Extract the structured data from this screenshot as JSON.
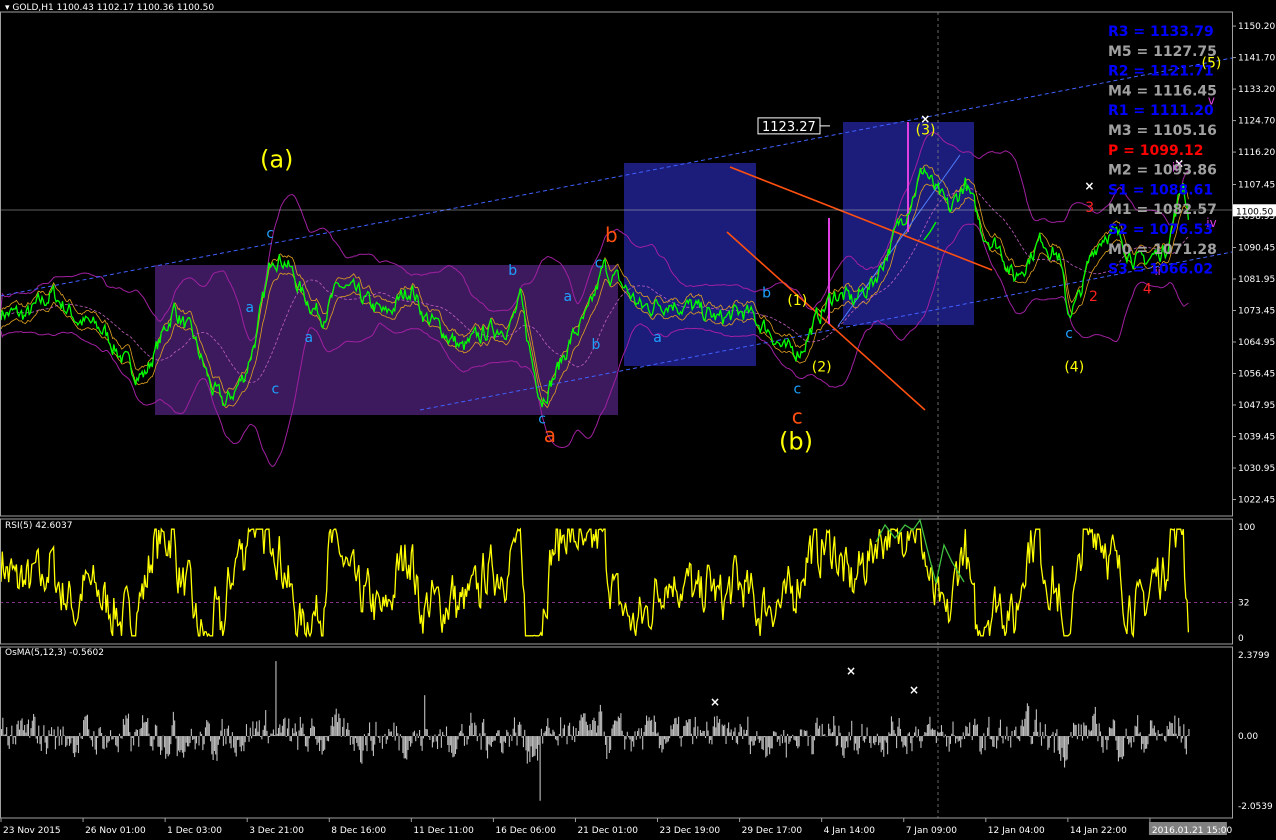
{
  "window": {
    "title": "GOLD,H1  1100.43 1102.17 1100.36 1100.50",
    "rsi_title": "RSI(5) 42.6037",
    "osma_title": "OsMA(5,12,3) -0.5602"
  },
  "colors": {
    "background": "#000000",
    "price_line": "#00ff00",
    "rsi_line": "#ffff00",
    "osma_bars": "#c0c0c0",
    "envelope": "#a020a0",
    "channel": "#4060ff",
    "trend": "#ff5010",
    "box_purple": "#3d1a5e",
    "box_blue": "#1c1c7a",
    "pivot_blue": "#0000ff",
    "pivot_gray": "#a0a0a0",
    "pivot_red": "#ff0000"
  },
  "chart_data": [
    {
      "type": "line",
      "panel": "price",
      "symbol": "GOLD",
      "timeframe": "H1",
      "ylim": [
        1018.0,
        1154.0
      ],
      "y_ticks": [
        "1150.20",
        "1141.70",
        "1133.20",
        "1124.70",
        "1116.20",
        "1107.45",
        "1098.95",
        "1090.45",
        "1081.95",
        "1073.45",
        "1064.95",
        "1056.45",
        "1047.95",
        "1039.45",
        "1030.95",
        "1022.45"
      ],
      "y_tick_values": [
        1150.2,
        1141.7,
        1133.2,
        1124.7,
        1116.2,
        1107.45,
        1098.95,
        1090.45,
        1081.95,
        1073.45,
        1064.95,
        1056.45,
        1047.95,
        1039.45,
        1030.95,
        1022.45
      ],
      "x_ticks": [
        "23 Nov 2015",
        "26 Nov 01:00",
        "1 Dec 03:00",
        "3 Dec 21:00",
        "8 Dec 16:00",
        "11 Dec 11:00",
        "16 Dec 06:00",
        "21 Dec 01:00",
        "23 Dec 19:00",
        "29 Dec 17:00",
        "4 Jan 14:00",
        "7 Jan 09:00",
        "12 Jan 04:00",
        "14 Jan 22:00",
        "2016.01.21 15:00"
      ],
      "x_tick_index": [
        0,
        64,
        128,
        192,
        256,
        320,
        384,
        448,
        512,
        576,
        640,
        704,
        768,
        832,
        896
      ],
      "current_price": "1100.50",
      "current_value": 1100.5,
      "marker_label": "1123.27",
      "marker_value": 1123.27,
      "pivots": [
        {
          "label": "R3",
          "value": "1133.79",
          "color": "#0000ff"
        },
        {
          "label": "M5",
          "value": "1127.75",
          "color": "#a0a0a0"
        },
        {
          "label": "R2",
          "value": "1121.71",
          "color": "#0000ff"
        },
        {
          "label": "M4",
          "value": "1116.45",
          "color": "#a0a0a0"
        },
        {
          "label": "R1",
          "value": "1111.20",
          "color": "#0000ff"
        },
        {
          "label": "M3",
          "value": "1105.16",
          "color": "#a0a0a0"
        },
        {
          "label": "P",
          "value": "1099.12",
          "color": "#ff0000"
        },
        {
          "label": "M2",
          "value": "1093.86",
          "color": "#a0a0a0"
        },
        {
          "label": "S1",
          "value": "1088.61",
          "color": "#0000ff"
        },
        {
          "label": "M1",
          "value": "1082.57",
          "color": "#a0a0a0"
        },
        {
          "label": "S2",
          "value": "1076.53",
          "color": "#0000ff"
        },
        {
          "label": "M0",
          "value": "1071.28",
          "color": "#a0a0a0"
        },
        {
          "label": "S3",
          "value": "1066.02",
          "color": "#0000ff"
        }
      ],
      "price_anchors": [
        [
          0,
          1073
        ],
        [
          20,
          1072
        ],
        [
          40,
          1078
        ],
        [
          60,
          1071
        ],
        [
          80,
          1068
        ],
        [
          100,
          1058
        ],
        [
          112,
          1056
        ],
        [
          125,
          1066
        ],
        [
          135,
          1074
        ],
        [
          150,
          1066
        ],
        [
          165,
          1052
        ],
        [
          175,
          1048
        ],
        [
          190,
          1056
        ],
        [
          200,
          1068
        ],
        [
          212,
          1089
        ],
        [
          222,
          1087
        ],
        [
          235,
          1078
        ],
        [
          250,
          1072
        ],
        [
          265,
          1080
        ],
        [
          280,
          1077
        ],
        [
          300,
          1072
        ],
        [
          320,
          1080
        ],
        [
          330,
          1072
        ],
        [
          345,
          1068
        ],
        [
          360,
          1063
        ],
        [
          380,
          1068
        ],
        [
          398,
          1070
        ],
        [
          405,
          1076
        ],
        [
          415,
          1058
        ],
        [
          422,
          1050
        ],
        [
          432,
          1056
        ],
        [
          445,
          1066
        ],
        [
          458,
          1072
        ],
        [
          470,
          1085
        ],
        [
          485,
          1080
        ],
        [
          500,
          1074
        ],
        [
          520,
          1076
        ],
        [
          540,
          1074
        ],
        [
          560,
          1071
        ],
        [
          580,
          1073
        ],
        [
          600,
          1068
        ],
        [
          612,
          1062
        ],
        [
          624,
          1063
        ],
        [
          636,
          1071
        ],
        [
          650,
          1078
        ],
        [
          665,
          1076
        ],
        [
          680,
          1081
        ],
        [
          695,
          1092
        ],
        [
          710,
          1104
        ],
        [
          720,
          1112
        ],
        [
          728,
          1106
        ],
        [
          740,
          1100
        ],
        [
          752,
          1108
        ],
        [
          765,
          1095
        ],
        [
          780,
          1090
        ],
        [
          790,
          1082
        ],
        [
          800,
          1087
        ],
        [
          812,
          1093
        ],
        [
          825,
          1088
        ],
        [
          832,
          1073
        ],
        [
          840,
          1076
        ],
        [
          846,
          1083
        ],
        [
          852,
          1090
        ],
        [
          862,
          1095
        ],
        [
          875,
          1092
        ],
        [
          888,
          1086
        ],
        [
          898,
          1088
        ],
        [
          908,
          1090
        ],
        [
          916,
          1100
        ],
        [
          922,
          1108
        ],
        [
          926,
          1100
        ]
      ],
      "annotations": [
        {
          "text": "(a)",
          "color": "#ffff00",
          "index": 215,
          "value": 1112,
          "size": 24
        },
        {
          "text": "(b)",
          "color": "#ffff00",
          "index": 620,
          "value": 1036,
          "size": 24
        },
        {
          "text": "(1)",
          "color": "#ffff00",
          "index": 621,
          "value": 1075,
          "size": 14
        },
        {
          "text": "(2)",
          "color": "#ffff00",
          "index": 640,
          "value": 1057,
          "size": 14
        },
        {
          "text": "(3)",
          "color": "#ffff00",
          "index": 721,
          "value": 1121,
          "size": 14
        },
        {
          "text": "(4)",
          "color": "#ffff00",
          "index": 837,
          "value": 1057,
          "size": 14
        },
        {
          "text": "(5)",
          "color": "#ffff00",
          "index": 944,
          "value": 1139,
          "size": 14
        },
        {
          "text": "a",
          "color": "#ff5010",
          "index": 428,
          "value": 1038,
          "size": 20
        },
        {
          "text": "b",
          "color": "#ff5010",
          "index": 476,
          "value": 1092,
          "size": 20
        },
        {
          "text": "c",
          "color": "#ff5010",
          "index": 621,
          "value": 1043,
          "size": 20
        },
        {
          "text": "a",
          "color": "#1ea0ff",
          "index": 194,
          "value": 1073,
          "size": 14
        },
        {
          "text": "a",
          "color": "#1ea0ff",
          "index": 240,
          "value": 1065,
          "size": 14
        },
        {
          "text": "c",
          "color": "#1ea0ff",
          "index": 210,
          "value": 1093,
          "size": 14
        },
        {
          "text": "c",
          "color": "#1ea0ff",
          "index": 214,
          "value": 1051,
          "size": 14
        },
        {
          "text": "b",
          "color": "#1ea0ff",
          "index": 399,
          "value": 1083,
          "size": 14
        },
        {
          "text": "a",
          "color": "#1ea0ff",
          "index": 442,
          "value": 1076,
          "size": 14
        },
        {
          "text": "c",
          "color": "#1ea0ff",
          "index": 466,
          "value": 1085,
          "size": 14
        },
        {
          "text": "b",
          "color": "#1ea0ff",
          "index": 464,
          "value": 1063,
          "size": 14
        },
        {
          "text": "a",
          "color": "#1ea0ff",
          "index": 512,
          "value": 1065,
          "size": 14
        },
        {
          "text": "b",
          "color": "#1ea0ff",
          "index": 597,
          "value": 1077,
          "size": 14
        },
        {
          "text": "c",
          "color": "#1ea0ff",
          "index": 422,
          "value": 1043,
          "size": 14
        },
        {
          "text": "c",
          "color": "#1ea0ff",
          "index": 621,
          "value": 1051,
          "size": 14
        },
        {
          "text": "c",
          "color": "#1ea0ff",
          "index": 833,
          "value": 1066,
          "size": 14
        },
        {
          "text": "2",
          "color": "#ff2020",
          "index": 852,
          "value": 1076,
          "size": 14
        },
        {
          "text": "3",
          "color": "#ff2020",
          "index": 849,
          "value": 1100,
          "size": 14
        },
        {
          "text": "4",
          "color": "#ff2020",
          "index": 894,
          "value": 1078,
          "size": 14
        },
        {
          "text": "iii",
          "color": "#e040e0",
          "index": 917,
          "value": 1111,
          "size": 12
        },
        {
          "text": "iv",
          "color": "#e040e0",
          "index": 944,
          "value": 1096,
          "size": 12
        },
        {
          "text": "v",
          "color": "#e040e0",
          "index": 944,
          "value": 1129,
          "size": 12
        },
        {
          "text": "ii",
          "color": "#e040e0",
          "index": 902,
          "value": 1083,
          "size": 11
        }
      ]
    },
    {
      "type": "line",
      "panel": "rsi",
      "name": "RSI(5)",
      "current": 42.6037,
      "ylim": [
        0,
        100
      ],
      "y_ticks": [
        "100",
        "32",
        "0"
      ],
      "y_tick_values": [
        100,
        32,
        0
      ],
      "level": 32
    },
    {
      "type": "bar",
      "panel": "osma",
      "name": "OsMA(5,12,3)",
      "current": -0.5602,
      "ylim": [
        -2.0539,
        2.3799
      ],
      "y_ticks": [
        "2.3799",
        "0.00",
        "-2.0539"
      ],
      "y_tick_values": [
        2.3799,
        0.0,
        -2.0539
      ]
    }
  ]
}
